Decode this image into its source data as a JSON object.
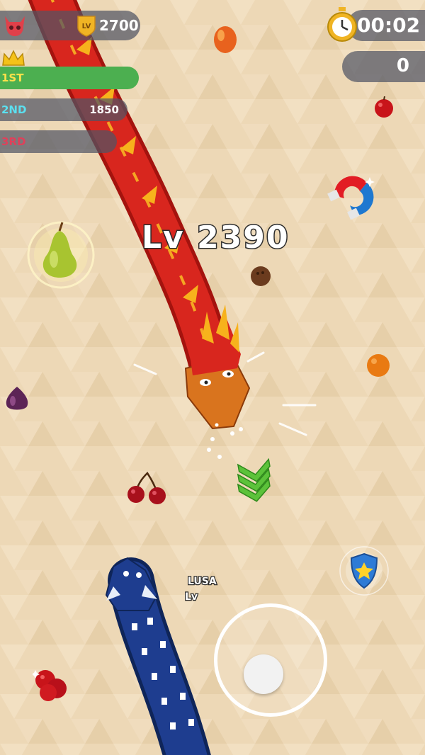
{
  "hud": {
    "level_badge": "LV",
    "level_value": "2700",
    "timer": "00:02",
    "score": "0"
  },
  "leaderboard": [
    {
      "rank": "1ST",
      "score": "",
      "rank_color": "#FFE14A",
      "bar_color": "#4CAF50"
    },
    {
      "rank": "2ND",
      "score": "1850",
      "rank_color": "#5BE0F0",
      "bar_color": "#5A5F72"
    },
    {
      "rank": "3RD",
      "score": "",
      "rank_color": "#E0405A",
      "bar_color": "#5A5F72"
    }
  ],
  "enemy": {
    "level_text": "Lv 2390",
    "color": "#D8261E",
    "head_color": "#D9741E"
  },
  "player": {
    "name": "LUSA",
    "level_text": "Lv",
    "color": "#1E3D8F"
  },
  "icons": {
    "enemy_avatar": "dragon-skull-icon",
    "crown": "crown-icon",
    "stopwatch": "stopwatch-icon",
    "magnet": "magnet-icon",
    "shield": "shield-star-icon",
    "boost": "chevron-down-icon"
  },
  "items": [
    "mango",
    "apple",
    "magnet",
    "pear",
    "coconut",
    "orange",
    "fig",
    "cherries",
    "shield",
    "apples"
  ],
  "colors": {
    "background": "#EDD8B6",
    "accent_green": "#4CAF50"
  }
}
